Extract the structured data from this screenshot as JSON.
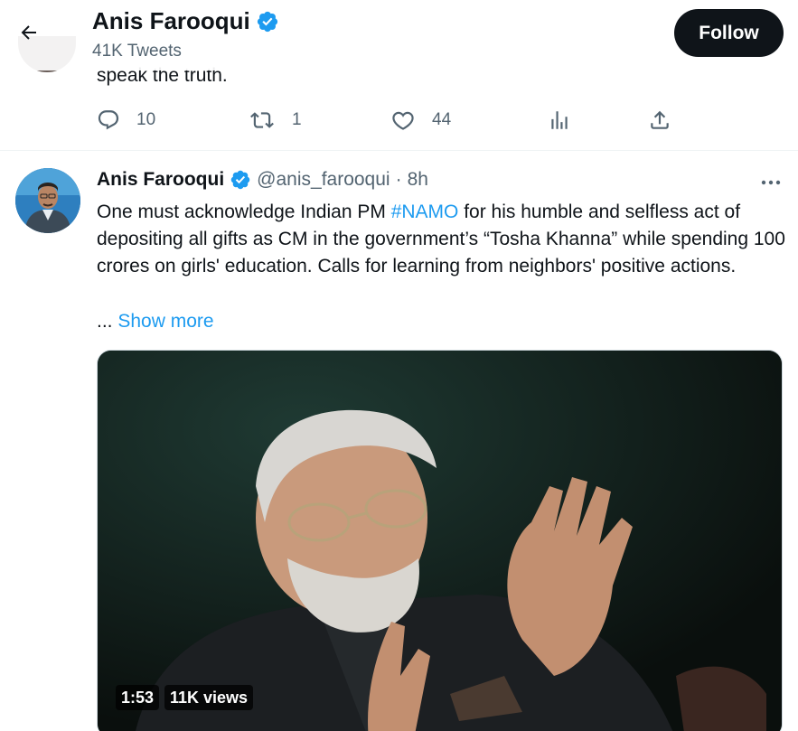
{
  "header": {
    "name": "Anis Farooqui",
    "tweet_count": "41K Tweets",
    "follow_label": "Follow"
  },
  "previous_tweet": {
    "text_tail": "speak the truth.",
    "replies": "10",
    "retweets": "1",
    "likes": "44"
  },
  "tweet": {
    "name": "Anis Farooqui",
    "handle": "@anis_farooqui",
    "separator": "·",
    "time": "8h",
    "text_before": "One must acknowledge Indian PM ",
    "hashtag": "#NAMO",
    "text_after": " for his humble and selfless act of depositing all gifts as CM in the government’s  “Tosha Khanna” while spending 100 crores on girls' education. Calls for learning from neighbors' positive actions.",
    "ellipsis": "...",
    "show_more": "Show more",
    "video": {
      "duration": "1:53",
      "views": "11K views"
    }
  },
  "colors": {
    "accent": "#1d9bf0",
    "text": "#0f1419",
    "secondary": "#536471",
    "verified": "#1d9bf0"
  },
  "icons": [
    "back-arrow-icon",
    "verified-badge-icon",
    "reply-icon",
    "retweet-icon",
    "like-icon",
    "analytics-icon",
    "share-icon",
    "more-icon"
  ]
}
